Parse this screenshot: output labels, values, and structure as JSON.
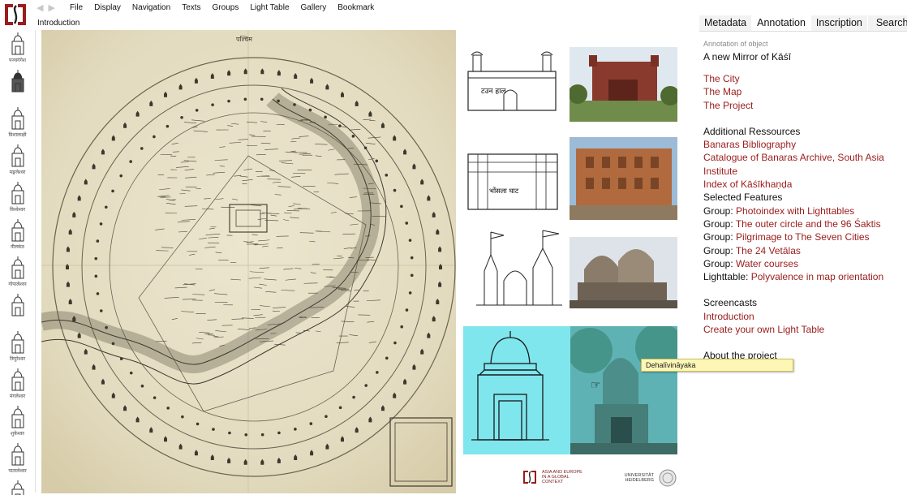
{
  "nav": {
    "logo_icon": "asia-europe-logo-icon",
    "back_icon": "back-arrow-icon",
    "forward_icon": "forward-arrow-icon"
  },
  "menu": {
    "items": [
      "File",
      "Display",
      "Navigation",
      "Texts",
      "Groups",
      "Light Table",
      "Gallery",
      "Bookmark"
    ]
  },
  "breadcrumb": "Introduction",
  "strip": {
    "captions": [
      "पञ्चगंगेश",
      "",
      "विशालाक्षी",
      "मङ्गलेश्वर",
      "विश्वेश्वर",
      "नीलकंठ",
      "गोपालेश्वर",
      "",
      "त्रिपुरेश्वर",
      "मंगलेश्वर",
      "शुकेश्वर",
      "पातालेश्वर",
      ""
    ]
  },
  "tabs": [
    "Metadata",
    "Annotation",
    "Inscription",
    "Search"
  ],
  "panel": {
    "caption": "Annotation of object",
    "title": "A new Mirror of Kāśī",
    "links1": [
      "The City",
      "The Map",
      "The Project"
    ],
    "additional_heading": "Additional Ressources",
    "additional": [
      "Banaras Bibliography",
      "Catalogue of Banaras Archive, South Asia Institute",
      "Index of Kāśīkhaṇḍa"
    ],
    "features_heading": "Selected Features",
    "features": [
      {
        "prefix": "Group: ",
        "link": "Photoindex with Lighttables"
      },
      {
        "prefix": "Group: ",
        "link": "The outer circle and the 96 Śaktis"
      },
      {
        "prefix": "Group: ",
        "link": "Pilgrimage to The Seven Cities"
      },
      {
        "prefix": "Group: ",
        "link": "The 24 Vetālas"
      },
      {
        "prefix": "Group: ",
        "link": "Water courses"
      },
      {
        "prefix": "Lighttable: ",
        "link": "Polyvalence in map orientation"
      }
    ],
    "screencasts_heading": "Screencasts",
    "screencasts": [
      "Introduction",
      "Create your own Light Table"
    ],
    "about": "About the project"
  },
  "tooltip": "Dehalīvināyaka",
  "sketch_labels": [
    "टउन हाल",
    "भोंसला घाट"
  ],
  "map_labels": {
    "top": "पश्चिम"
  },
  "footer": {
    "left_text": "ASIA AND EUROPE IN A GLOBAL CONTEXT",
    "right_text": "UNIVERSITÄT HEIDELBERG"
  },
  "colors": {
    "link": "#9a1c1c",
    "highlight": "#7fe6ee",
    "tooltip": "#fdf7b5",
    "map_paper": "#e6dfc6"
  }
}
